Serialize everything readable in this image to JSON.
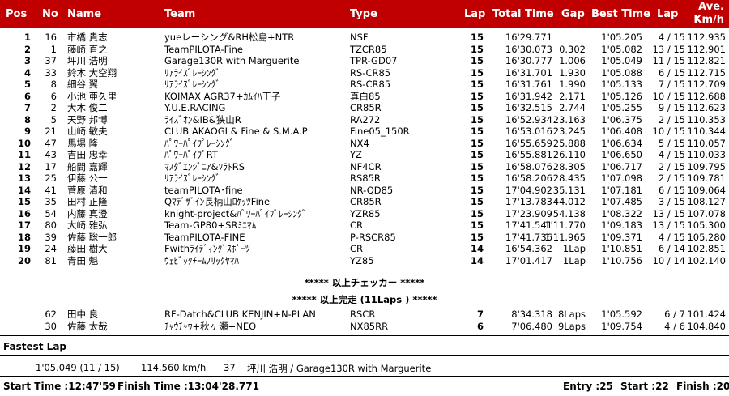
{
  "header": {
    "pos": "Pos",
    "no": "No",
    "name": "Name",
    "team": "Team",
    "type": "Type",
    "lap": "Lap",
    "total_time": "Total Time",
    "gap": "Gap",
    "best_time": "Best Time",
    "best_lap": "Lap",
    "ave_line1": "Ave.",
    "ave_line2": "Km/h"
  },
  "rows": [
    {
      "pos": "1",
      "no": "16",
      "name": "市橋 貴志",
      "team": "yueレーシング&RH松島+NTR",
      "type": "NSF",
      "lap": "15",
      "total": "16'29.771",
      "gap": "",
      "best": "1'05.205",
      "bestlap": "4 / 15",
      "ave": "112.935"
    },
    {
      "pos": "2",
      "no": "1",
      "name": "藤崎 直之",
      "team": "TeamPILOTA-Fine",
      "type": "TZCR85",
      "lap": "15",
      "total": "16'30.073",
      "gap": "0.302",
      "best": "1'05.082",
      "bestlap": "13 / 15",
      "ave": "112.901"
    },
    {
      "pos": "3",
      "no": "37",
      "name": "坪川 浩明",
      "team": "Garage130R with Marguerite",
      "type": "TPR-GD07",
      "lap": "15",
      "total": "16'30.777",
      "gap": "1.006",
      "best": "1'05.049",
      "bestlap": "11 / 15",
      "ave": "112.821"
    },
    {
      "pos": "4",
      "no": "33",
      "name": "鈴木 大空翔",
      "team": "ﾘｱﾗｲｽﾞﾚｰｼﾝｸﾞ",
      "type": "RS-CR85",
      "lap": "15",
      "total": "16'31.701",
      "gap": "1.930",
      "best": "1'05.088",
      "bestlap": "6 / 15",
      "ave": "112.715"
    },
    {
      "pos": "5",
      "no": "8",
      "name": "細谷 翼",
      "team": "ﾘｱﾗｲｽﾞﾚｰｼﾝｸﾞ",
      "type": "RS-CR85",
      "lap": "15",
      "total": "16'31.761",
      "gap": "1.990",
      "best": "1'05.133",
      "bestlap": "7 / 15",
      "ave": "112.709"
    },
    {
      "pos": "6",
      "no": "6",
      "name": "小池 亜久里",
      "team": "KOIMAX AGR37+ｶﾑｲﾊ王子",
      "type": "真白85",
      "lap": "15",
      "total": "16'31.942",
      "gap": "2.171",
      "best": "1'05.126",
      "bestlap": "10 / 15",
      "ave": "112.688"
    },
    {
      "pos": "7",
      "no": "2",
      "name": "大木 俊二",
      "team": "Y.U.E.RACING",
      "type": "CR85R",
      "lap": "15",
      "total": "16'32.515",
      "gap": "2.744",
      "best": "1'05.255",
      "bestlap": "9 / 15",
      "ave": "112.623"
    },
    {
      "pos": "8",
      "no": "5",
      "name": "天野 邦博",
      "team": "ﾗｲｽﾞｵﾝ&IB&狭山R",
      "type": "RA272",
      "lap": "15",
      "total": "16'52.934",
      "gap": "23.163",
      "best": "1'06.375",
      "bestlap": "2 / 15",
      "ave": "110.353"
    },
    {
      "pos": "9",
      "no": "21",
      "name": "山崎 敏夫",
      "team": "CLUB AKAOGI & Fine & S.M.A.P",
      "type": "Fine05_150R",
      "lap": "15",
      "total": "16'53.016",
      "gap": "23.245",
      "best": "1'06.408",
      "bestlap": "10 / 15",
      "ave": "110.344"
    },
    {
      "pos": "10",
      "no": "47",
      "name": "馬場 隆",
      "team": "ﾊﾟﾜｰﾊﾟｲﾌﾟﾚｰｼﾝｸﾞ",
      "type": "NX4",
      "lap": "15",
      "total": "16'55.659",
      "gap": "25.888",
      "best": "1'06.634",
      "bestlap": "5 / 15",
      "ave": "110.057"
    },
    {
      "pos": "11",
      "no": "43",
      "name": "吉田 忠幸",
      "team": "ﾊﾟﾜｰﾊﾟｲﾌﾟRT",
      "type": "YZ",
      "lap": "15",
      "total": "16'55.881",
      "gap": "26.110",
      "best": "1'06.650",
      "bestlap": "4 / 15",
      "ave": "110.033"
    },
    {
      "pos": "12",
      "no": "17",
      "name": "船間 嘉輝",
      "team": "ﾏｽﾀﾞｴﾝｼﾞﾆｱ&ｿﾗﾄRS",
      "type": "NF4CR",
      "lap": "15",
      "total": "16'58.076",
      "gap": "28.305",
      "best": "1'06.717",
      "bestlap": "2 / 15",
      "ave": "109.795"
    },
    {
      "pos": "13",
      "no": "25",
      "name": "伊藤 公一",
      "team": "ﾘｱﾗｲｽﾞﾚｰｼﾝｸﾞ",
      "type": "RS85R",
      "lap": "15",
      "total": "16'58.206",
      "gap": "28.435",
      "best": "1'07.098",
      "bestlap": "2 / 15",
      "ave": "109.781"
    },
    {
      "pos": "14",
      "no": "41",
      "name": "菅原 清和",
      "team": "teamPILOTA･fine",
      "type": "NR-QD85",
      "lap": "15",
      "total": "17'04.902",
      "gap": "35.131",
      "best": "1'07.181",
      "bestlap": "6 / 15",
      "ave": "109.064"
    },
    {
      "pos": "15",
      "no": "35",
      "name": "田村 正隆",
      "team": "Qﾏﾃﾞｻﾞｲﾝ長柄山ﾛｹｯﾂFine",
      "type": "CR85R",
      "lap": "15",
      "total": "17'13.783",
      "gap": "44.012",
      "best": "1'07.485",
      "bestlap": "3 / 15",
      "ave": "108.127"
    },
    {
      "pos": "16",
      "no": "54",
      "name": "内藤 真澄",
      "team": "knight-project&ﾊﾟﾜｰﾊﾟｲﾌﾟﾚｰｼﾝｸﾞ",
      "type": "YZR85",
      "lap": "15",
      "total": "17'23.909",
      "gap": "54.138",
      "best": "1'08.322",
      "bestlap": "13 / 15",
      "ave": "107.078"
    },
    {
      "pos": "17",
      "no": "80",
      "name": "大崎 雅弘",
      "team": "Team-GP80+SRﾐﾆﾏﾑ",
      "type": "CR",
      "lap": "15",
      "total": "17'41.541",
      "gap": "1'11.770",
      "best": "1'09.183",
      "bestlap": "13 / 15",
      "ave": "105.300"
    },
    {
      "pos": "18",
      "no": "39",
      "name": "佐藤 聡一郎",
      "team": "TeamPILOTA-FINE",
      "type": "P-RSCR85",
      "lap": "15",
      "total": "17'41.736",
      "gap": "1'11.965",
      "best": "1'09.371",
      "bestlap": "4 / 15",
      "ave": "105.280"
    },
    {
      "pos": "19",
      "no": "24",
      "name": "藤田 樹大",
      "team": "Fwithﾗｲﾃﾞｨﾝｸﾞｽﾎﾟｰﾂ",
      "type": "CR",
      "lap": "14",
      "total": "16'54.362",
      "gap": "1Lap",
      "best": "1'10.851",
      "bestlap": "6 / 14",
      "ave": "102.851"
    },
    {
      "pos": "20",
      "no": "81",
      "name": "青田 魁",
      "team": "ｳｪﾋﾞｯｸﾁｰﾑﾉﾘｯｸﾔﾏﾊ",
      "type": "YZ85",
      "lap": "14",
      "total": "17'01.417",
      "gap": "1Lap",
      "best": "1'10.756",
      "bestlap": "10 / 14",
      "ave": "102.140"
    }
  ],
  "checker_note": "***** 以上チェッカー *****",
  "finish_note": "***** 以上完走 (11Laps ) *****",
  "extra_rows": [
    {
      "pos": "",
      "no": "62",
      "name": "田中 良",
      "team": "RF-Datch&CLUB KENJIN+N-PLAN",
      "type": "RSCR",
      "lap": "7",
      "total": "8'34.318",
      "gap": "8Laps",
      "best": "1'05.592",
      "bestlap": "6 / 7",
      "ave": "101.424"
    },
    {
      "pos": "",
      "no": "30",
      "name": "佐藤 太哉",
      "team": "ﾁｬｳﾁｬｳ+秋ヶ瀬+NEO",
      "type": "NX85RR",
      "lap": "6",
      "total": "7'06.480",
      "gap": "9Laps",
      "best": "1'09.754",
      "bestlap": "4 / 6",
      "ave": "104.840"
    }
  ],
  "fastest_lap": {
    "title": "Fastest Lap",
    "time": "1'05.049 (11 / 15)",
    "speed": "114.560 km/h",
    "no": "37",
    "driver": "坪川 浩明 / Garage130R with Marguerite"
  },
  "footer": {
    "start_time": "Start Time :12:47'59",
    "finish_time": "Finish Time :13:04'28.771",
    "entry": "Entry :25",
    "start": "Start :22",
    "finish": "Finish :20"
  },
  "colors": {
    "header_bg": "#c00000",
    "header_text": "#ffffff"
  }
}
